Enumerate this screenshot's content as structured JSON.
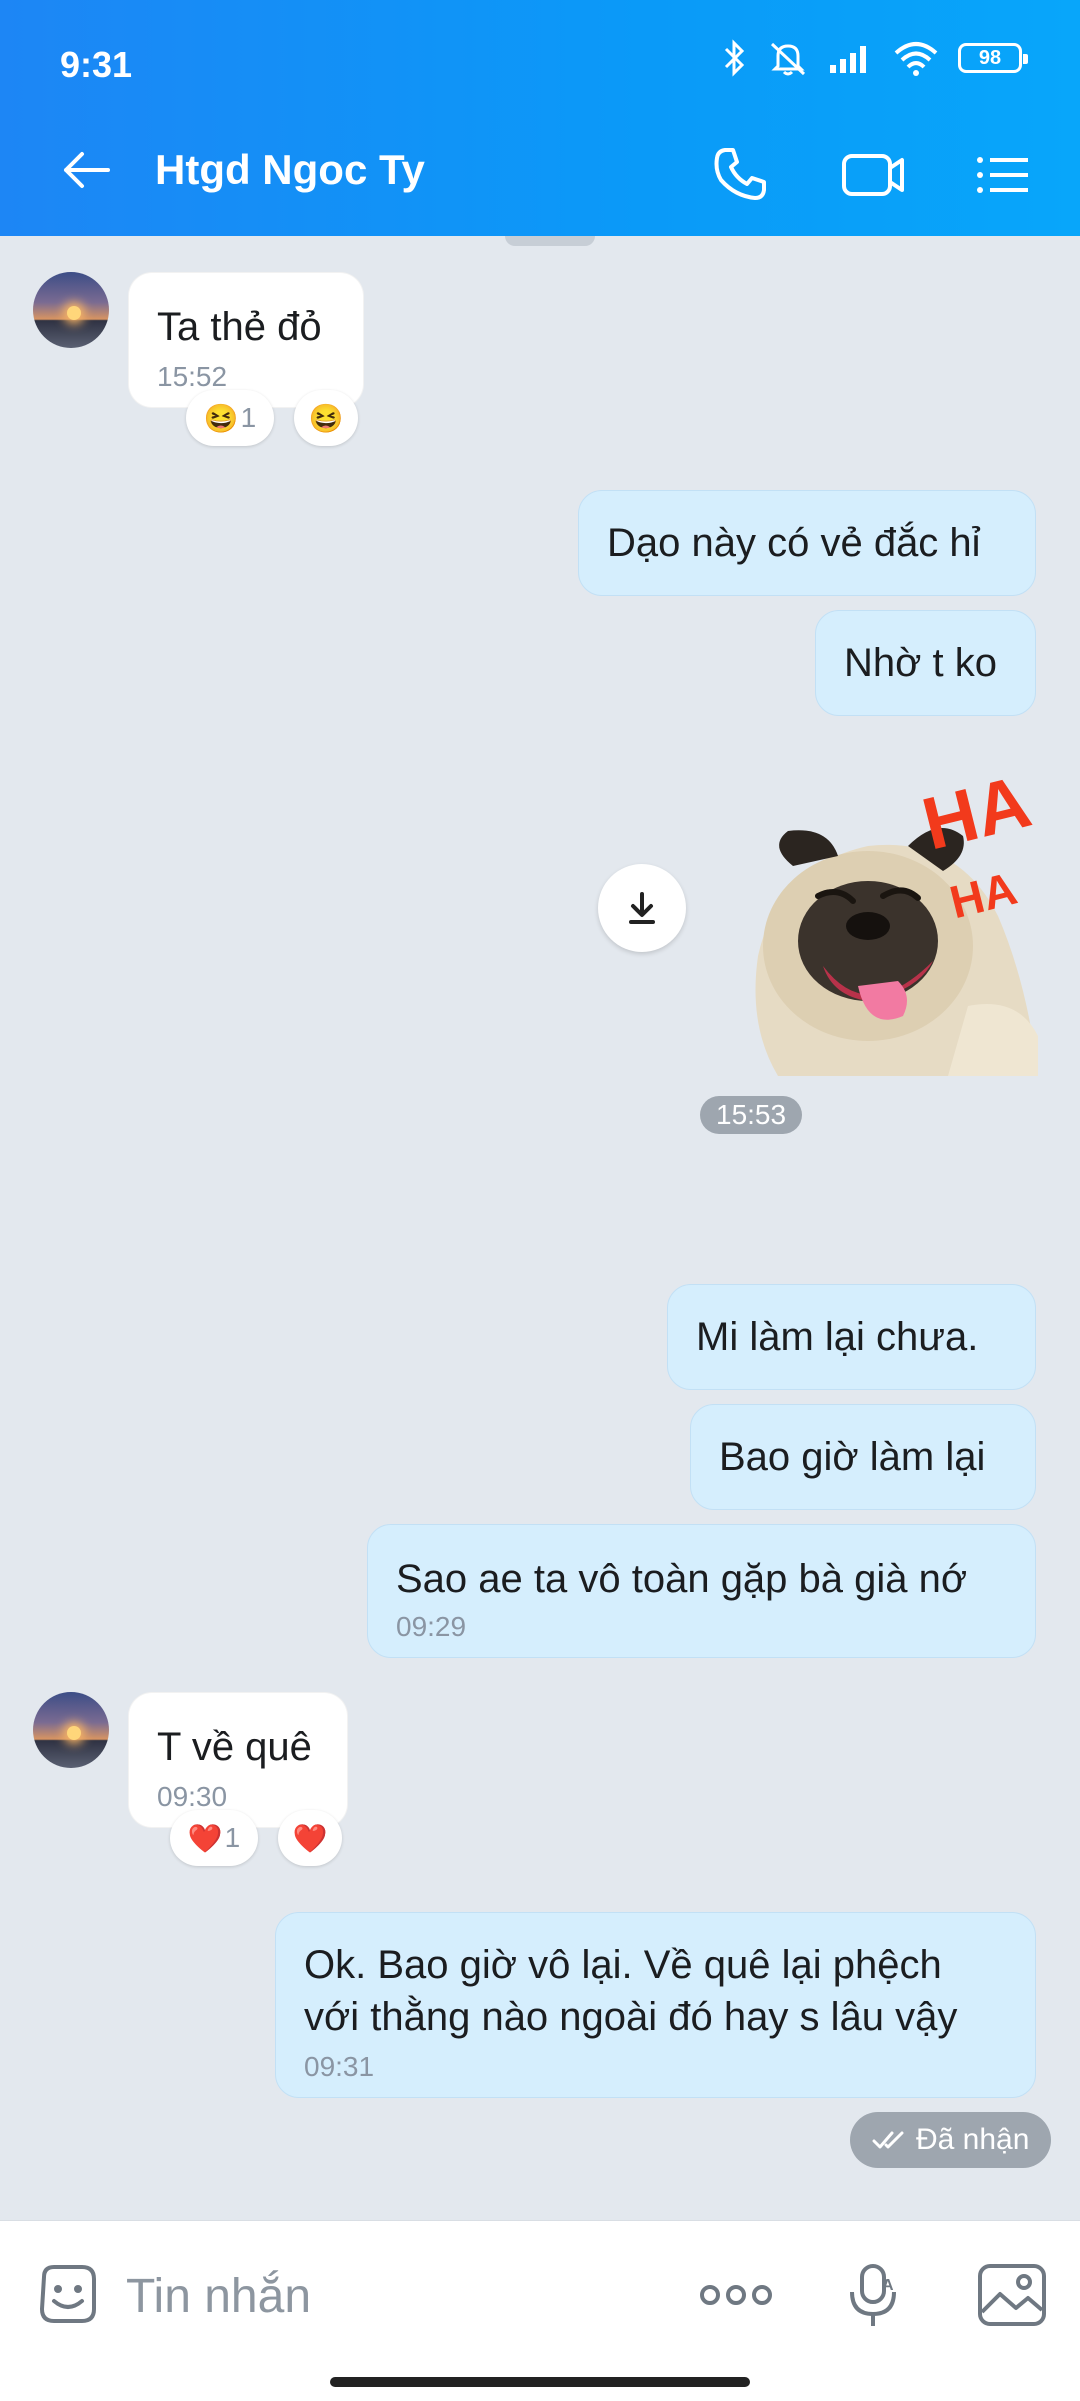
{
  "status_bar": {
    "time": "9:31",
    "battery": "98"
  },
  "header": {
    "title": "Htgd Ngoc Ty"
  },
  "messages": [
    {
      "dir": "in",
      "text": "Ta thẻ đỏ",
      "time": "15:52",
      "reactions": [
        {
          "emoji": "😆",
          "count": "1"
        },
        {
          "emoji": "😆"
        }
      ]
    },
    {
      "dir": "out",
      "text": "Dạo này có vẻ đắc hỉ"
    },
    {
      "dir": "out",
      "text": "Nhờ t ko"
    },
    {
      "dir": "out",
      "type": "sticker",
      "sticker_text": "HA",
      "sticker_text2": "HA",
      "time": "15:53"
    },
    {
      "dir": "out",
      "text": "Mi làm lại chưa."
    },
    {
      "dir": "out",
      "text": "Bao giờ làm lại"
    },
    {
      "dir": "out",
      "text": "Sao ae ta vô toàn gặp bà già nớ",
      "time": "09:29"
    },
    {
      "dir": "in",
      "text": "T về quê",
      "time": "09:30",
      "reactions": [
        {
          "emoji": "❤️",
          "count": "1"
        },
        {
          "emoji": "❤️"
        }
      ]
    },
    {
      "dir": "out",
      "lines": [
        "Ok. Bao giờ vô lại. Về quê lại phệch",
        "với thằng nào ngoài đó hay s lâu vậy"
      ],
      "time": "09:31"
    }
  ],
  "delivery_status": "Đã nhận",
  "input": {
    "placeholder": "Tin nhắn"
  },
  "icons": {
    "back": "arrow-left-icon",
    "call": "phone-icon",
    "video": "video-camera-icon",
    "menu": "list-menu-icon",
    "sticker": "emoji-sticker-icon",
    "more": "more-dots-icon",
    "voice": "microphone-icon",
    "image": "image-gallery-icon",
    "download": "download-icon"
  },
  "colors": {
    "header_start": "#1d86f5",
    "header_end": "#08a6fa",
    "outgoing_bubble": "#d5eefd",
    "incoming_bubble": "#ffffff",
    "background": "#e3e8ee"
  }
}
